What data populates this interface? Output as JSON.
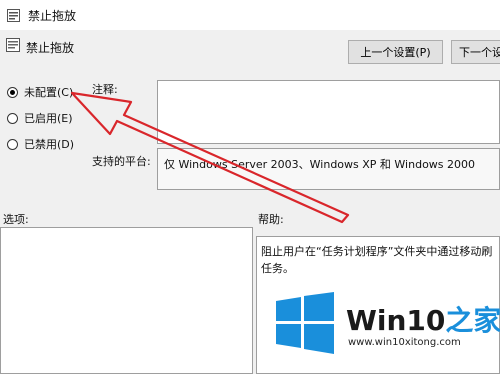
{
  "window": {
    "title": "禁止拖放"
  },
  "header": {
    "policy_name": "禁止拖放"
  },
  "nav": {
    "prev_label": "上一个设置(P)",
    "next_label": "下一个设"
  },
  "state": {
    "options": [
      {
        "label": "未配置(C)",
        "checked": true
      },
      {
        "label": "已启用(E)",
        "checked": false
      },
      {
        "label": "已禁用(D)",
        "checked": false
      }
    ]
  },
  "comment": {
    "label": "注释:",
    "value": ""
  },
  "platform": {
    "label": "支持的平台:",
    "value": "仅 Windows Server 2003、Windows XP 和 Windows 2000"
  },
  "options_panel": {
    "label": "选项:"
  },
  "help_panel": {
    "label": "帮助:",
    "text_line1": "阻止用户在“任务计划程序”文件夹中通过移动刷",
    "text_line2": "任务。"
  },
  "annotation": {
    "color": "#d9262b",
    "shape": "arrow-pointing-to-not-configured"
  },
  "watermark": {
    "brand_main": "Win10",
    "brand_accent": "之家",
    "url": "www.win10xitong.com",
    "logo_color": "#1a8fdb"
  }
}
